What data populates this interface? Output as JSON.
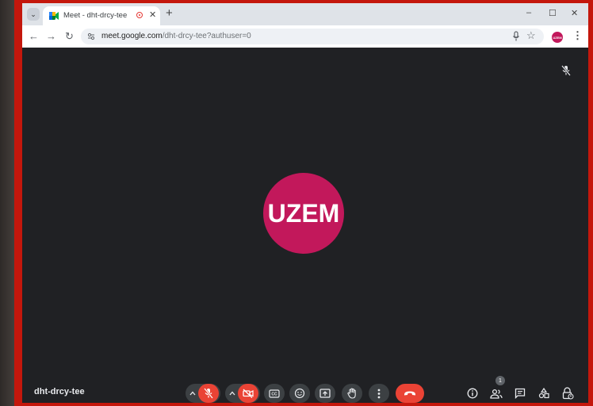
{
  "browser": {
    "tab": {
      "title": "Meet - dht-drcy-tee",
      "close_icon": "✕"
    },
    "new_tab_icon": "+",
    "window_controls": {
      "minimize": "–",
      "maximize": "☐",
      "close": "✕"
    },
    "url_host": "meet.google.com",
    "url_path": "/dht-drcy-tee?authuser=0",
    "profile_label": "UZEM"
  },
  "meet": {
    "avatar_label": "UZEM",
    "avatar_color": "#c2185b",
    "meeting_code": "dht-drcy-tee",
    "participants_count": "1",
    "end_call_color": "#ea4335"
  }
}
